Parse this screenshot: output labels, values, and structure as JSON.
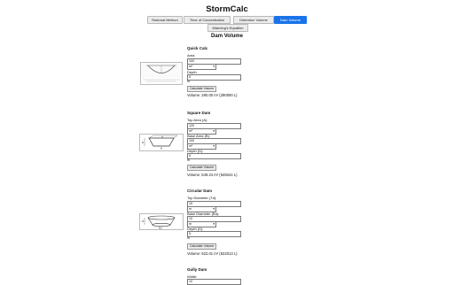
{
  "app": {
    "title": "StormCalc"
  },
  "nav": {
    "rational": "Rational Method",
    "toc": "Time of Concentration",
    "detention": "Detention Volume",
    "dam": "Dam Volume",
    "manning": "Manning's Equation"
  },
  "page": {
    "heading": "Dam Volume"
  },
  "quick": {
    "heading": "Quick Calc",
    "area_label": "Area",
    "area_value": "100",
    "area_unit": "m²",
    "depth_label": "Depth",
    "depth_value": "5",
    "depth_unit": "m",
    "button": "Calculate Volume",
    "result": "Volume: 290.00 m³ (290000 L)"
  },
  "square": {
    "heading": "Square Dam",
    "top_label": "Top Area (A):",
    "top_value": "120",
    "top_unit": "m²",
    "base_label": "Base Area (B):",
    "base_value": "100",
    "base_unit": "m²",
    "depth_label": "Depth (D):",
    "depth_value": "5",
    "depth_unit": "m",
    "button": "Calculate Volume",
    "result": "Volume: 549.24 m³ (549241 L)"
  },
  "circular": {
    "heading": "Circular Dam",
    "top_label": "Top Diameter (Td):",
    "top_value": "15",
    "top_unit": "m",
    "base_label": "Base Diameter (Bd):",
    "base_value": "10",
    "base_unit": "m",
    "depth_label": "Depth (D):",
    "depth_value": "5",
    "depth_unit": "m",
    "button": "Calculate Volume",
    "result": "Volume: 622.01 m³ (622013 L)"
  },
  "gully": {
    "heading": "Gully Dam",
    "width_label": "Width:",
    "width_value": "10"
  }
}
